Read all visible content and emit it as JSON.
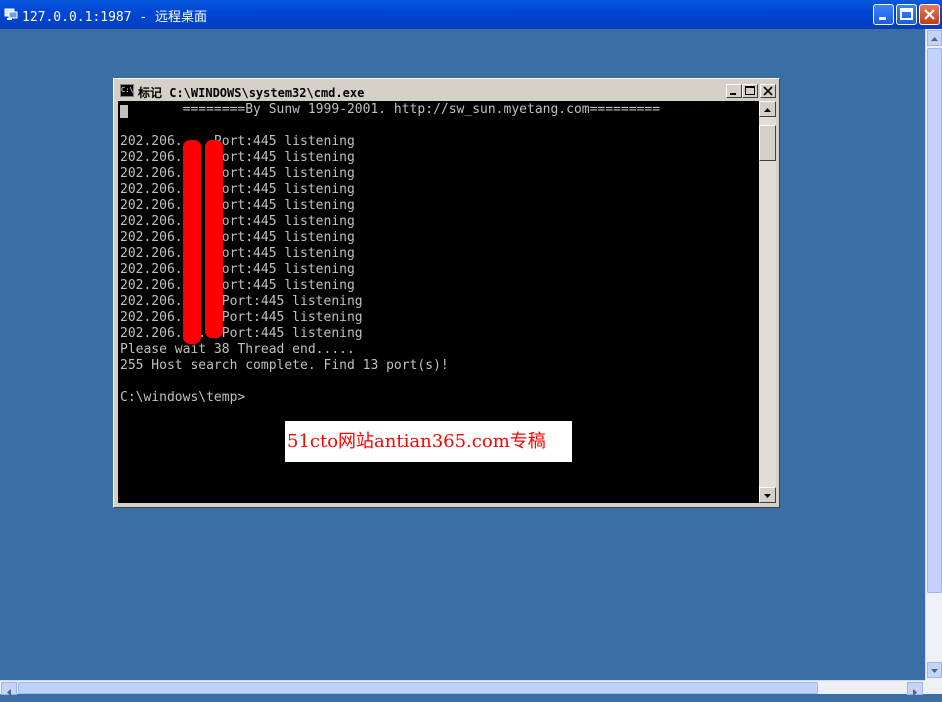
{
  "remote_window": {
    "title": "127.0.0.1:1987 - 远程桌面",
    "icon": "remote-desktop-icon",
    "controls": [
      "minimize-icon",
      "maximize-icon",
      "close-icon"
    ],
    "colors": {
      "titlebar": "#0046d5",
      "desktop": "#3a6ea5"
    }
  },
  "cmd_window": {
    "title": "标记 C:\\WINDOWS\\system32\\cmd.exe",
    "icon_text": "C:\\",
    "controls": [
      "minimize-icon",
      "maximize-icon",
      "close-icon"
    ]
  },
  "console": {
    "lines": [
      "        ========By Sunw 1999-2001. http://sw_sun.myetang.com=========",
      "",
      "202.206.    Port:445 listening",
      "202.206.    Port:445 listening",
      "202.206.    Port:445 listening",
      "202.206.    Port:445 listening",
      "202.206.    Port:445 listening",
      "202.206.    Port:445 listening",
      "202.206.    Port:445 listening",
      "202.206.    Port:445 listening",
      "202.206.    Port:445 listening",
      "202.206.    Port:445 listening",
      "202.206.   0 Port:445 listening",
      "202.206.   2 Port:445 listening",
      "202.206.  .4 Port:445 listening",
      "Please wait 38 Thread end.....",
      "255 Host search complete. Find 13 port(s)!",
      "",
      "C:\\windows\\temp>"
    ]
  },
  "watermark": {
    "text": "51cto网站antian365.com专稿",
    "color": "#ff0000"
  },
  "redaction_color": "#ff0000"
}
